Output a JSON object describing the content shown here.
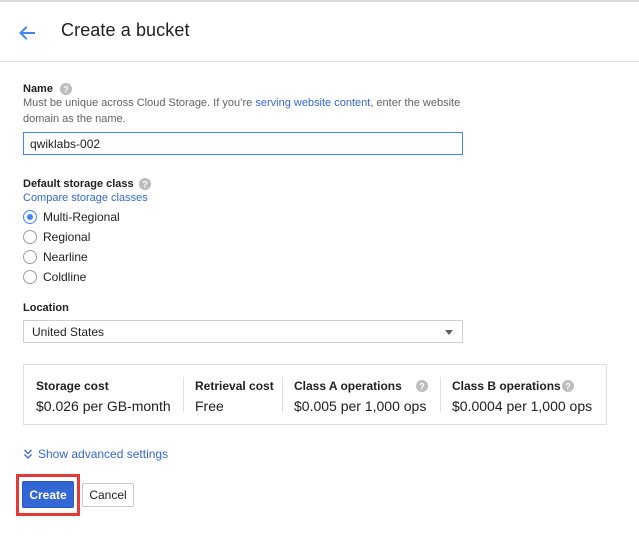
{
  "header": {
    "title": "Create a bucket",
    "back_icon": "arrow-back-icon"
  },
  "name_section": {
    "label": "Name",
    "help_icon": "help-icon",
    "hint_before": "Must be unique across Cloud Storage. If you’re ",
    "hint_link": "serving website content",
    "hint_after": ", enter the website",
    "hint_line2": "domain as the name.",
    "value": "qwiklabs-002"
  },
  "storage_class": {
    "label": "Default storage class",
    "help_icon": "help-icon",
    "compare_link": "Compare storage classes",
    "options": [
      {
        "label": "Multi-Regional",
        "checked": true
      },
      {
        "label": "Regional",
        "checked": false
      },
      {
        "label": "Nearline",
        "checked": false
      },
      {
        "label": "Coldline",
        "checked": false
      }
    ]
  },
  "location": {
    "label": "Location",
    "selected": "United States"
  },
  "costs": [
    {
      "heading": "Storage cost",
      "value": "$0.026 per GB-month",
      "has_help": false
    },
    {
      "heading": "Retrieval cost",
      "value": "Free",
      "has_help": false
    },
    {
      "heading": "Class A operations",
      "value": "$0.005 per 1,000 ops",
      "has_help": true
    },
    {
      "heading": "Class B operations",
      "value": "$0.0004 per 1,000 ops",
      "has_help": true
    }
  ],
  "advanced": {
    "label": "Show advanced settings",
    "icon": "chevron-double-down-icon"
  },
  "actions": {
    "create_label": "Create",
    "cancel_label": "Cancel"
  },
  "colors": {
    "accent": "#3367d6",
    "highlight": "#e53935"
  }
}
